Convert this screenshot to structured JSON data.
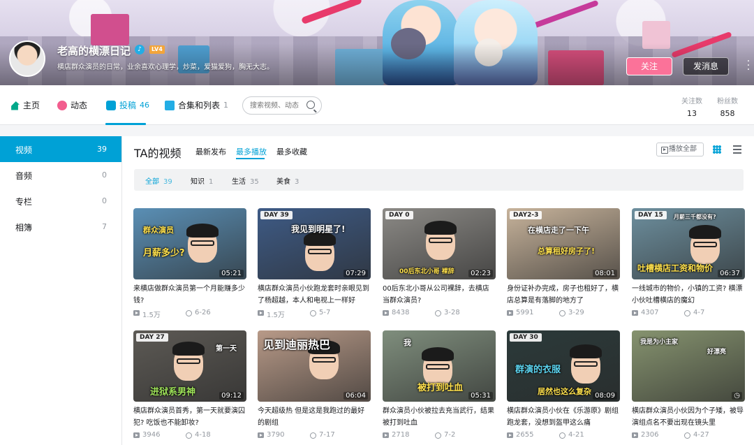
{
  "profile": {
    "name": "老高的横漂日记",
    "level": "LV4",
    "signature": "横店群众演员的日常，业余喜欢心理学，炒菜，爱猫爱狗，胸无大志。",
    "follow_label": "关注",
    "message_label": "发消息"
  },
  "nav": {
    "items": [
      {
        "label": "主页",
        "count": ""
      },
      {
        "label": "动态",
        "count": ""
      },
      {
        "label": "投稿",
        "count": "46"
      },
      {
        "label": "合集和列表",
        "count": "1"
      }
    ],
    "search_placeholder": "搜索视频、动态",
    "following_label": "关注数",
    "following_value": "13",
    "fans_label": "粉丝数",
    "fans_value": "858"
  },
  "sidebar": {
    "items": [
      {
        "label": "视频",
        "count": "39"
      },
      {
        "label": "音频",
        "count": "0"
      },
      {
        "label": "专栏",
        "count": "0"
      },
      {
        "label": "相簿",
        "count": "7"
      }
    ]
  },
  "main": {
    "title": "TA的视频",
    "sort": [
      "最新发布",
      "最多播放",
      "最多收藏"
    ],
    "play_all": "播放全部",
    "filters": [
      {
        "label": "全部",
        "count": "39"
      },
      {
        "label": "知识",
        "count": "1"
      },
      {
        "label": "生活",
        "count": "35"
      },
      {
        "label": "美食",
        "count": "3"
      }
    ]
  },
  "videos": [
    {
      "tag": "",
      "caption": "群众演员",
      "caption2": "月薪多少?",
      "duration": "05:21",
      "title": "来横店做群众演员第一个月能赚多少钱?",
      "views": "1.5万",
      "date": "6-26",
      "bg": "#5a8fb5"
    },
    {
      "tag": "DAY 39",
      "caption": "我见到明星了!",
      "caption2": "",
      "duration": "07:29",
      "title": "横店群众演员小伙跑龙套时亲眼见到了杨超越，本人和电视上一样好",
      "views": "1.5万",
      "date": "5-7",
      "bg": "#3e5b86"
    },
    {
      "tag": "DAY 0",
      "caption": "",
      "caption2": "00后东北小哥  裸辞",
      "duration": "02:23",
      "title": "00后东北小哥从公司裸辞，去横店当群众演员?",
      "views": "8438",
      "date": "3-28",
      "bg": "#8c8a86"
    },
    {
      "tag": "DAY2-3",
      "caption": "在横店走了一下午",
      "caption2": "总算租好房子了!",
      "duration": "08:01",
      "title": "身份证补办完成，房子也租好了，横店总算是有落脚的地方了",
      "views": "5991",
      "date": "3-29",
      "bg": "#c7b39b"
    },
    {
      "tag": "DAY 15",
      "caption": "月薪三千都没有?",
      "caption2": "吐槽横店工资和物价",
      "duration": "06:37",
      "title": "一线城市的物价，小镇的工资? 横漂小伙吐槽横店的魔幻",
      "views": "4307",
      "date": "4-7",
      "bg": "#6d8f9e"
    },
    {
      "tag": "DAY 27",
      "caption": "第一天",
      "caption2": "进狱系男神",
      "duration": "09:12",
      "title": "横店群众演员首秀，第一天就要演囚犯? 吃饭也不能卸妆?",
      "views": "3946",
      "date": "4-18",
      "bg": "#5d5a55"
    },
    {
      "tag": "",
      "caption": "见到迪丽热巴",
      "caption2": "",
      "duration": "06:04",
      "title": "今天超级热 但是这是我跑过的最好的剧组",
      "views": "3790",
      "date": "7-17",
      "bg": "#b89a88"
    },
    {
      "tag": "",
      "caption": "我",
      "caption2": "被打到吐血",
      "duration": "05:31",
      "title": "群众演员小伙被拉去充当武行，结果被打到吐血",
      "views": "2718",
      "date": "7-2",
      "bg": "#7f8e7d"
    },
    {
      "tag": "DAY 30",
      "caption": "群演的衣服",
      "caption2": "居然也这么复杂",
      "duration": "08:09",
      "title": "横店群众演员小伙在《乐游原》剧组跑龙套，没想到盔甲这么痛",
      "views": "2655",
      "date": "4-21",
      "bg": "#2b3a3a"
    },
    {
      "tag": "",
      "caption": "我是为小主家",
      "caption2": "好漂亮",
      "duration": "",
      "title": "横店群众演员小伙因为个子矮，被导演组点名不要出现在镜头里",
      "views": "2306",
      "date": "4-27",
      "bg": "#86936f"
    }
  ]
}
